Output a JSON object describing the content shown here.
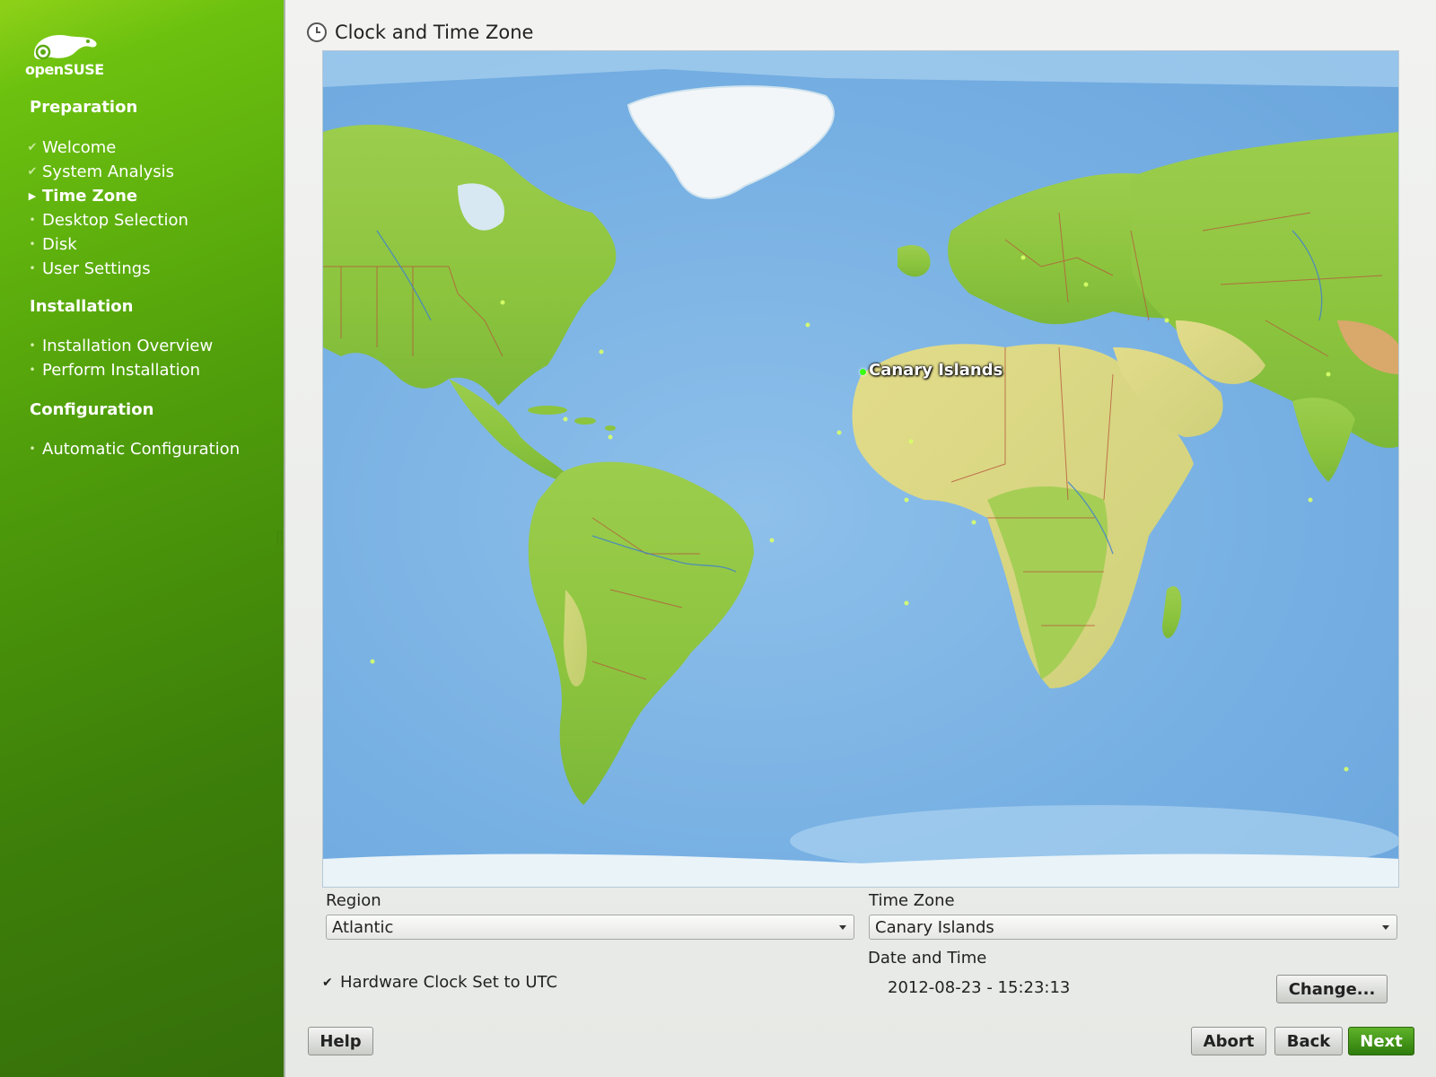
{
  "sidebar": {
    "logo_text": "openSUSE",
    "sections": [
      {
        "title": "Preparation"
      },
      {
        "title": "Installation"
      },
      {
        "title": "Configuration"
      }
    ],
    "steps": [
      {
        "label": "Welcome",
        "state": "done"
      },
      {
        "label": "System Analysis",
        "state": "done"
      },
      {
        "label": "Time Zone",
        "state": "current"
      },
      {
        "label": "Desktop Selection",
        "state": "pending"
      },
      {
        "label": "Disk",
        "state": "pending"
      },
      {
        "label": "User Settings",
        "state": "pending"
      },
      {
        "label": "Installation Overview",
        "state": "pending"
      },
      {
        "label": "Perform Installation",
        "state": "pending"
      },
      {
        "label": "Automatic Configuration",
        "state": "pending"
      }
    ]
  },
  "page": {
    "title": "Clock and Time Zone",
    "icon": "clock-icon"
  },
  "map": {
    "selected_label": "Canary Islands"
  },
  "form": {
    "region_label": "Region",
    "region_value": "Atlantic",
    "timezone_label": "Time Zone",
    "timezone_value": "Canary Islands",
    "date_time_label": "Date and Time",
    "date_time_value": "2012-08-23 - 15:23:13",
    "change_button": "Change...",
    "hw_clock_label": "Hardware Clock Set to UTC",
    "hw_clock_checked": true
  },
  "buttons": {
    "help": "Help",
    "abort": "Abort",
    "back": "Back",
    "next": "Next"
  },
  "colors": {
    "sidebar_green": "#4f9d0b",
    "next_green": "#3a8d12",
    "ocean": "#77b0e3",
    "land": "#8cc43e"
  }
}
